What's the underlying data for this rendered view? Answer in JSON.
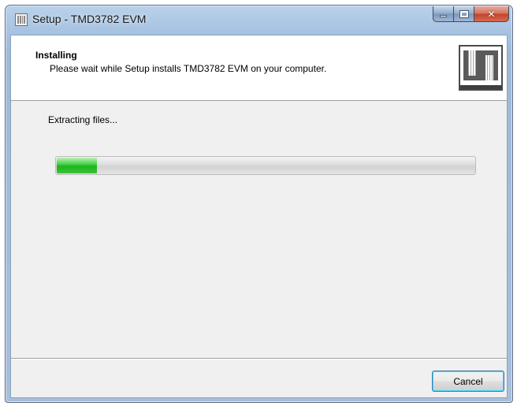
{
  "window": {
    "title": "Setup - TMD3782 EVM",
    "app_icon": "installer-logo-icon",
    "caption_buttons": [
      "minimize-icon",
      "maximize-icon",
      "close-icon"
    ]
  },
  "header": {
    "title": "Installing",
    "subtitle": "Please wait while Setup installs TMD3782 EVM on your computer.",
    "logo": "installer-logo"
  },
  "main": {
    "status": "Extracting files...",
    "progress": 0.1,
    "progress_color": "#26b526"
  },
  "footer": {
    "cancel_label": "Cancel"
  },
  "colors": {
    "title_bar": "#a9c4e2",
    "close_button": "#c2432a",
    "client_bg": "#f0f0f0",
    "button_focus_border": "#3c7fb1"
  }
}
